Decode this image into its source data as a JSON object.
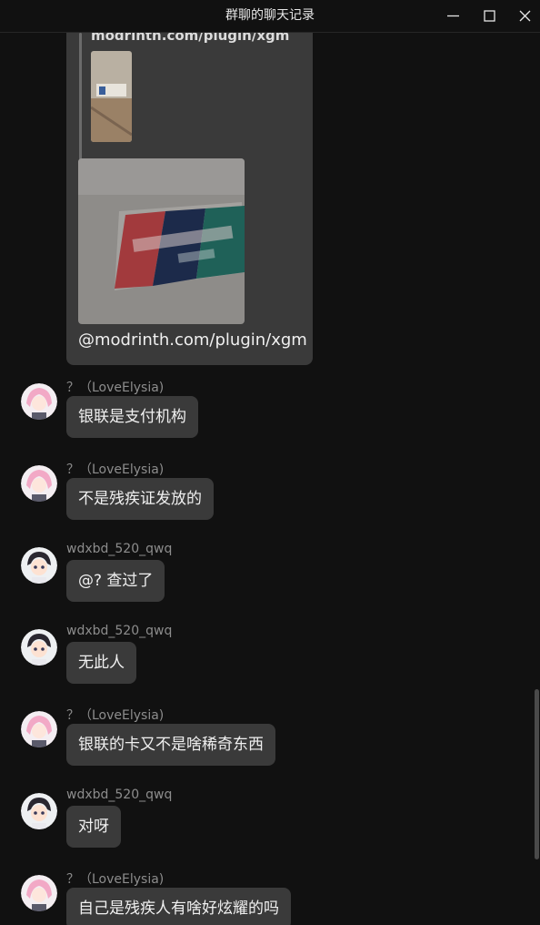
{
  "window": {
    "title": "群聊的聊天记录",
    "controls": [
      "minimize-icon",
      "maximize-icon",
      "close-icon"
    ]
  },
  "first_message": {
    "quote_text": "modrinth.com/plugin/xgm",
    "caption": "@modrinth.com/plugin/xgm"
  },
  "messages": [
    {
      "sender": "？（LoveElysia)",
      "text": "银联是支付机构",
      "avatar": "pink-hair-anime-avatar"
    },
    {
      "sender": "？（LoveElysia)",
      "text": "不是残疾证发放的",
      "avatar": "pink-hair-anime-avatar"
    },
    {
      "sender": "wdxbd_520_qwq",
      "text": "@? 查过了",
      "avatar": "dark-hair-boy-avatar"
    },
    {
      "sender": "wdxbd_520_qwq",
      "text": "无此人",
      "avatar": "dark-hair-boy-avatar"
    },
    {
      "sender": "？（LoveElysia)",
      "text": "银联的卡又不是啥稀奇东西",
      "avatar": "pink-hair-anime-avatar"
    },
    {
      "sender": "wdxbd_520_qwq",
      "text": "对呀",
      "avatar": "dark-hair-boy-avatar"
    },
    {
      "sender": "？（LoveElysia)",
      "text": "自己是残疾人有啥好炫耀的吗",
      "avatar": "pink-hair-anime-avatar"
    }
  ]
}
